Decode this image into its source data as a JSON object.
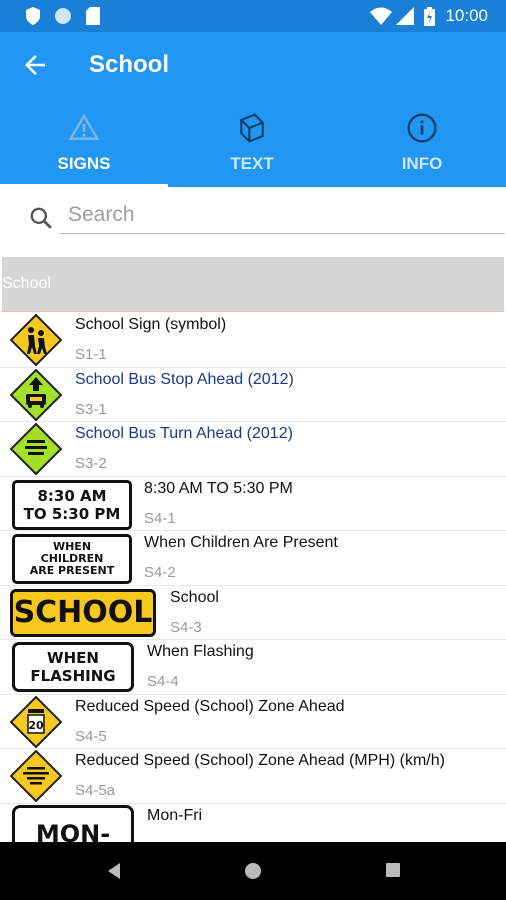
{
  "status_bar": {
    "time": "10:00"
  },
  "app_bar": {
    "title": "School"
  },
  "tabs": [
    {
      "label": "SIGNS",
      "icon": "warning-icon",
      "active": true
    },
    {
      "label": "TEXT",
      "icon": "book-icon",
      "active": false
    },
    {
      "label": "INFO",
      "icon": "info-icon",
      "active": false
    }
  ],
  "search": {
    "placeholder": "Search"
  },
  "section": {
    "header": "School"
  },
  "signs": [
    {
      "name": "School Sign (symbol)",
      "code": "S1-1"
    },
    {
      "name": "School Bus Stop Ahead (2012)",
      "code": "S3-1"
    },
    {
      "name": "School Bus Turn Ahead (2012)",
      "code": "S3-2"
    },
    {
      "name": "8:30 AM TO 5:30 PM",
      "code": "S4-1",
      "plate_line1": "8:30 AM",
      "plate_line2": "TO 5:30 PM"
    },
    {
      "name": "When Children Are Present",
      "code": "S4-2",
      "plate_line1": "WHEN",
      "plate_line2": "CHILDREN",
      "plate_line3": "ARE PRESENT"
    },
    {
      "name": "School",
      "code": "S4-3",
      "plate_text": "SCHOOL"
    },
    {
      "name": "When Flashing",
      "code": "S4-4",
      "plate_line1": "WHEN",
      "plate_line2": "FLASHING"
    },
    {
      "name": "Reduced Speed (School) Zone Ahead",
      "code": "S4-5",
      "sign_number": "20"
    },
    {
      "name": "Reduced Speed (School) Zone Ahead (MPH) (km/h)",
      "code": "S4-5a"
    },
    {
      "name": "Mon-Fri",
      "code": "",
      "plate_text": "MON-FRI"
    }
  ],
  "colors": {
    "primary": "#2196f3",
    "status_bar": "#1a7fd6",
    "school_yellow": "#f7c81e",
    "school_green": "#a4e028",
    "link_blue": "#1a3a8f"
  }
}
